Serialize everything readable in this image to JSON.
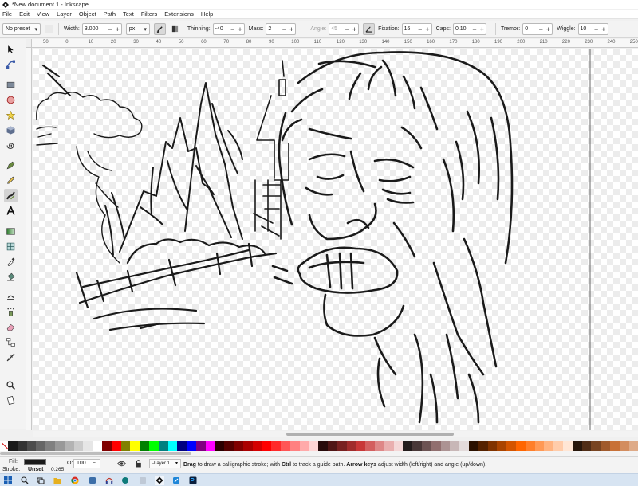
{
  "window": {
    "title": "*New document 1 - Inkscape"
  },
  "menu": [
    "File",
    "Edit",
    "View",
    "Layer",
    "Object",
    "Path",
    "Text",
    "Filters",
    "Extensions",
    "Help"
  ],
  "toolbar": {
    "preset": "No preset",
    "width_label": "Width:",
    "width_value": "3.000",
    "unit": "px",
    "thinning_label": "Thinning:",
    "thinning_value": "-40",
    "mass_label": "Mass:",
    "mass_value": "2",
    "angle_label": "Angle:",
    "angle_value": "45",
    "fixation_label": "Fixation:",
    "fixation_value": "16",
    "caps_label": "Caps:",
    "caps_value": "0.10",
    "tremor_label": "Tremor:",
    "tremor_value": "0",
    "wiggle_label": "Wiggle:",
    "wiggle_value": "10"
  },
  "ruler": {
    "ticks": [
      "50",
      "0",
      "10",
      "20",
      "30",
      "40",
      "50",
      "60",
      "70",
      "80",
      "90",
      "100",
      "110",
      "120",
      "130",
      "140",
      "150",
      "160",
      "170",
      "180",
      "190",
      "200",
      "210",
      "220",
      "230",
      "240",
      "250",
      "260"
    ]
  },
  "tools": [
    "selector-tool",
    "node-tool",
    "rectangle-tool",
    "ellipse-tool",
    "star-tool",
    "3d-box-tool",
    "spiral-tool",
    "pen-tool",
    "pencil-tool",
    "calligraphy-tool",
    "text-tool",
    "gradient-tool",
    "mesh-tool",
    "dropper-tool",
    "paint-bucket-tool",
    "tweak-tool",
    "spray-tool",
    "eraser-tool",
    "connector-tool",
    "measure-tool",
    "zoom-tool",
    "pages-tool"
  ],
  "status": {
    "fill_label": "Fill:",
    "stroke_label": "Stroke:",
    "stroke_value": "Unset",
    "stroke_width": "0.265",
    "opacity_label": "O:",
    "opacity_value": "100",
    "layer": "-Layer 1",
    "message_parts": [
      {
        "text": "Drag",
        "bold": true
      },
      {
        "text": " to draw a calligraphic stroke; with ",
        "bold": false
      },
      {
        "text": "Ctrl",
        "bold": true
      },
      {
        "text": " to track a guide path. ",
        "bold": false
      },
      {
        "text": "Arrow keys",
        "bold": true
      },
      {
        "text": " adjust width (left/right) and angle (up/down).",
        "bold": false
      }
    ]
  },
  "palette": [
    "#1a1a1a",
    "#333333",
    "#4d4d4d",
    "#666666",
    "#808080",
    "#999999",
    "#b3b3b3",
    "#cccccc",
    "#e6e6e6",
    "#ffffff",
    "#800000",
    "#ff0000",
    "#808000",
    "#ffff00",
    "#008000",
    "#00ff00",
    "#008080",
    "#00ffff",
    "#000080",
    "#0000ff",
    "#800080",
    "#ff00ff",
    "#2b0000",
    "#550000",
    "#800000",
    "#aa0000",
    "#d40000",
    "#ff0000",
    "#ff2a2a",
    "#ff5555",
    "#ff8080",
    "#ffaaaa",
    "#ffd5d5",
    "#280b0b",
    "#501616",
    "#782121",
    "#a02c2c",
    "#c83737",
    "#d35f5f",
    "#de8787",
    "#e9afaf",
    "#f4d7d7",
    "#241c1c",
    "#483737",
    "#6c5353",
    "#916f6f",
    "#ac9393",
    "#c8b7b7",
    "#e3dbdb",
    "#2b1100",
    "#552200",
    "#803300",
    "#aa4400",
    "#d45500",
    "#ff6600",
    "#ff7f2a",
    "#ff9955",
    "#ffb380",
    "#ffccaa",
    "#ffe6d5",
    "#28170b",
    "#502d16",
    "#784421",
    "#a05a2c",
    "#c87137",
    "#d38d5f",
    "#deaa87"
  ]
}
